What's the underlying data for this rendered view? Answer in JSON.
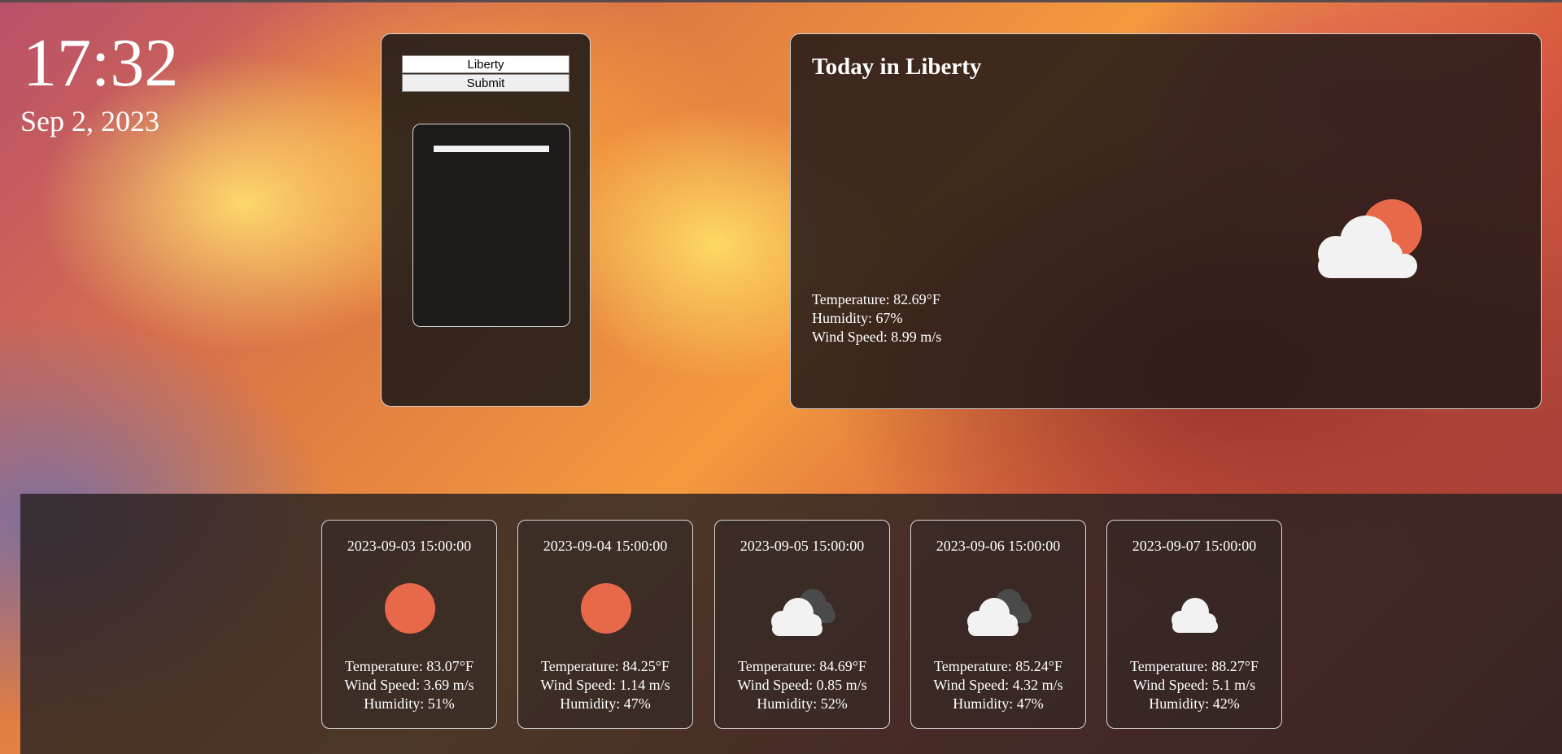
{
  "clock": {
    "time": "17:32",
    "date": "Sep 2, 2023"
  },
  "search": {
    "city_value": "Liberty",
    "submit_label": "Submit"
  },
  "today": {
    "title": "Today in Liberty",
    "icon": "partly-cloudy-icon",
    "temperature": "Temperature: 82.69°F",
    "humidity": "Humidity: 67%",
    "wind": "Wind Speed: 8.99 m/s"
  },
  "forecast": [
    {
      "date": "2023-09-03 15:00:00",
      "icon": "sun-icon",
      "temperature": "Temperature: 83.07°F",
      "wind": "Wind Speed: 3.69 m/s",
      "humidity": "Humidity: 51%"
    },
    {
      "date": "2023-09-04 15:00:00",
      "icon": "sun-icon",
      "temperature": "Temperature: 84.25°F",
      "wind": "Wind Speed: 1.14 m/s",
      "humidity": "Humidity: 47%"
    },
    {
      "date": "2023-09-05 15:00:00",
      "icon": "broken-clouds-icon",
      "temperature": "Temperature: 84.69°F",
      "wind": "Wind Speed: 0.85 m/s",
      "humidity": "Humidity: 52%"
    },
    {
      "date": "2023-09-06 15:00:00",
      "icon": "broken-clouds-icon",
      "temperature": "Temperature: 85.24°F",
      "wind": "Wind Speed: 4.32 m/s",
      "humidity": "Humidity: 47%"
    },
    {
      "date": "2023-09-07 15:00:00",
      "icon": "cloud-icon",
      "temperature": "Temperature: 88.27°F",
      "wind": "Wind Speed: 5.1 m/s",
      "humidity": "Humidity: 42%"
    }
  ],
  "colors": {
    "sun": "#e8694a",
    "cloud": "#f2f2f2",
    "dark_cloud": "#4a4a4a"
  }
}
